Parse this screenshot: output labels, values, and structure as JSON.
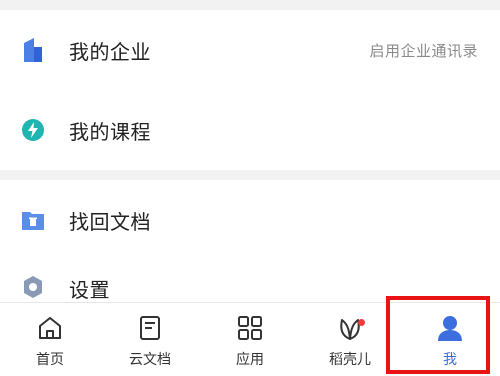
{
  "menu": {
    "items": [
      {
        "label": "我的企业",
        "hint": "启用企业通讯录",
        "icon": "building-icon"
      },
      {
        "label": "我的课程",
        "icon": "course-icon"
      },
      {
        "label": "找回文档",
        "icon": "recycle-folder-icon"
      },
      {
        "label": "设置",
        "icon": "settings-icon"
      }
    ]
  },
  "tabbar": {
    "tabs": [
      {
        "label": "首页",
        "icon": "home-icon"
      },
      {
        "label": "云文档",
        "icon": "document-icon"
      },
      {
        "label": "应用",
        "icon": "apps-grid-icon"
      },
      {
        "label": "稻壳儿",
        "icon": "leaf-icon",
        "badge": true
      },
      {
        "label": "我",
        "icon": "user-icon",
        "active": true
      }
    ]
  },
  "colors": {
    "accent": "#3d6ee0",
    "teal": "#1fb5b0",
    "badge": "#ef3b3b",
    "highlight": "#e81414"
  }
}
